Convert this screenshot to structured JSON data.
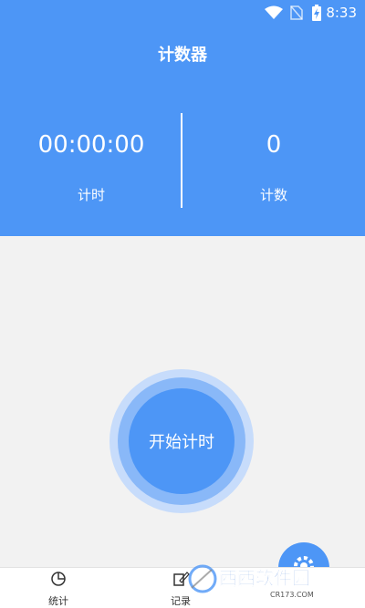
{
  "status_bar": {
    "time": "8:33"
  },
  "header": {
    "title": "计数器",
    "timer": {
      "value": "00:00:00",
      "label": "计时"
    },
    "counter": {
      "value": "0",
      "label": "计数"
    }
  },
  "main": {
    "start_button_label": "开始计时"
  },
  "tabs": [
    {
      "label": "统计",
      "icon": "pie-chart-icon"
    },
    {
      "label": "记录",
      "icon": "edit-icon"
    }
  ],
  "watermark": {
    "text": "西西软件园",
    "sub": "CR173.COM"
  },
  "colors": {
    "primary": "#4d96f6",
    "background": "#f2f2f2"
  }
}
